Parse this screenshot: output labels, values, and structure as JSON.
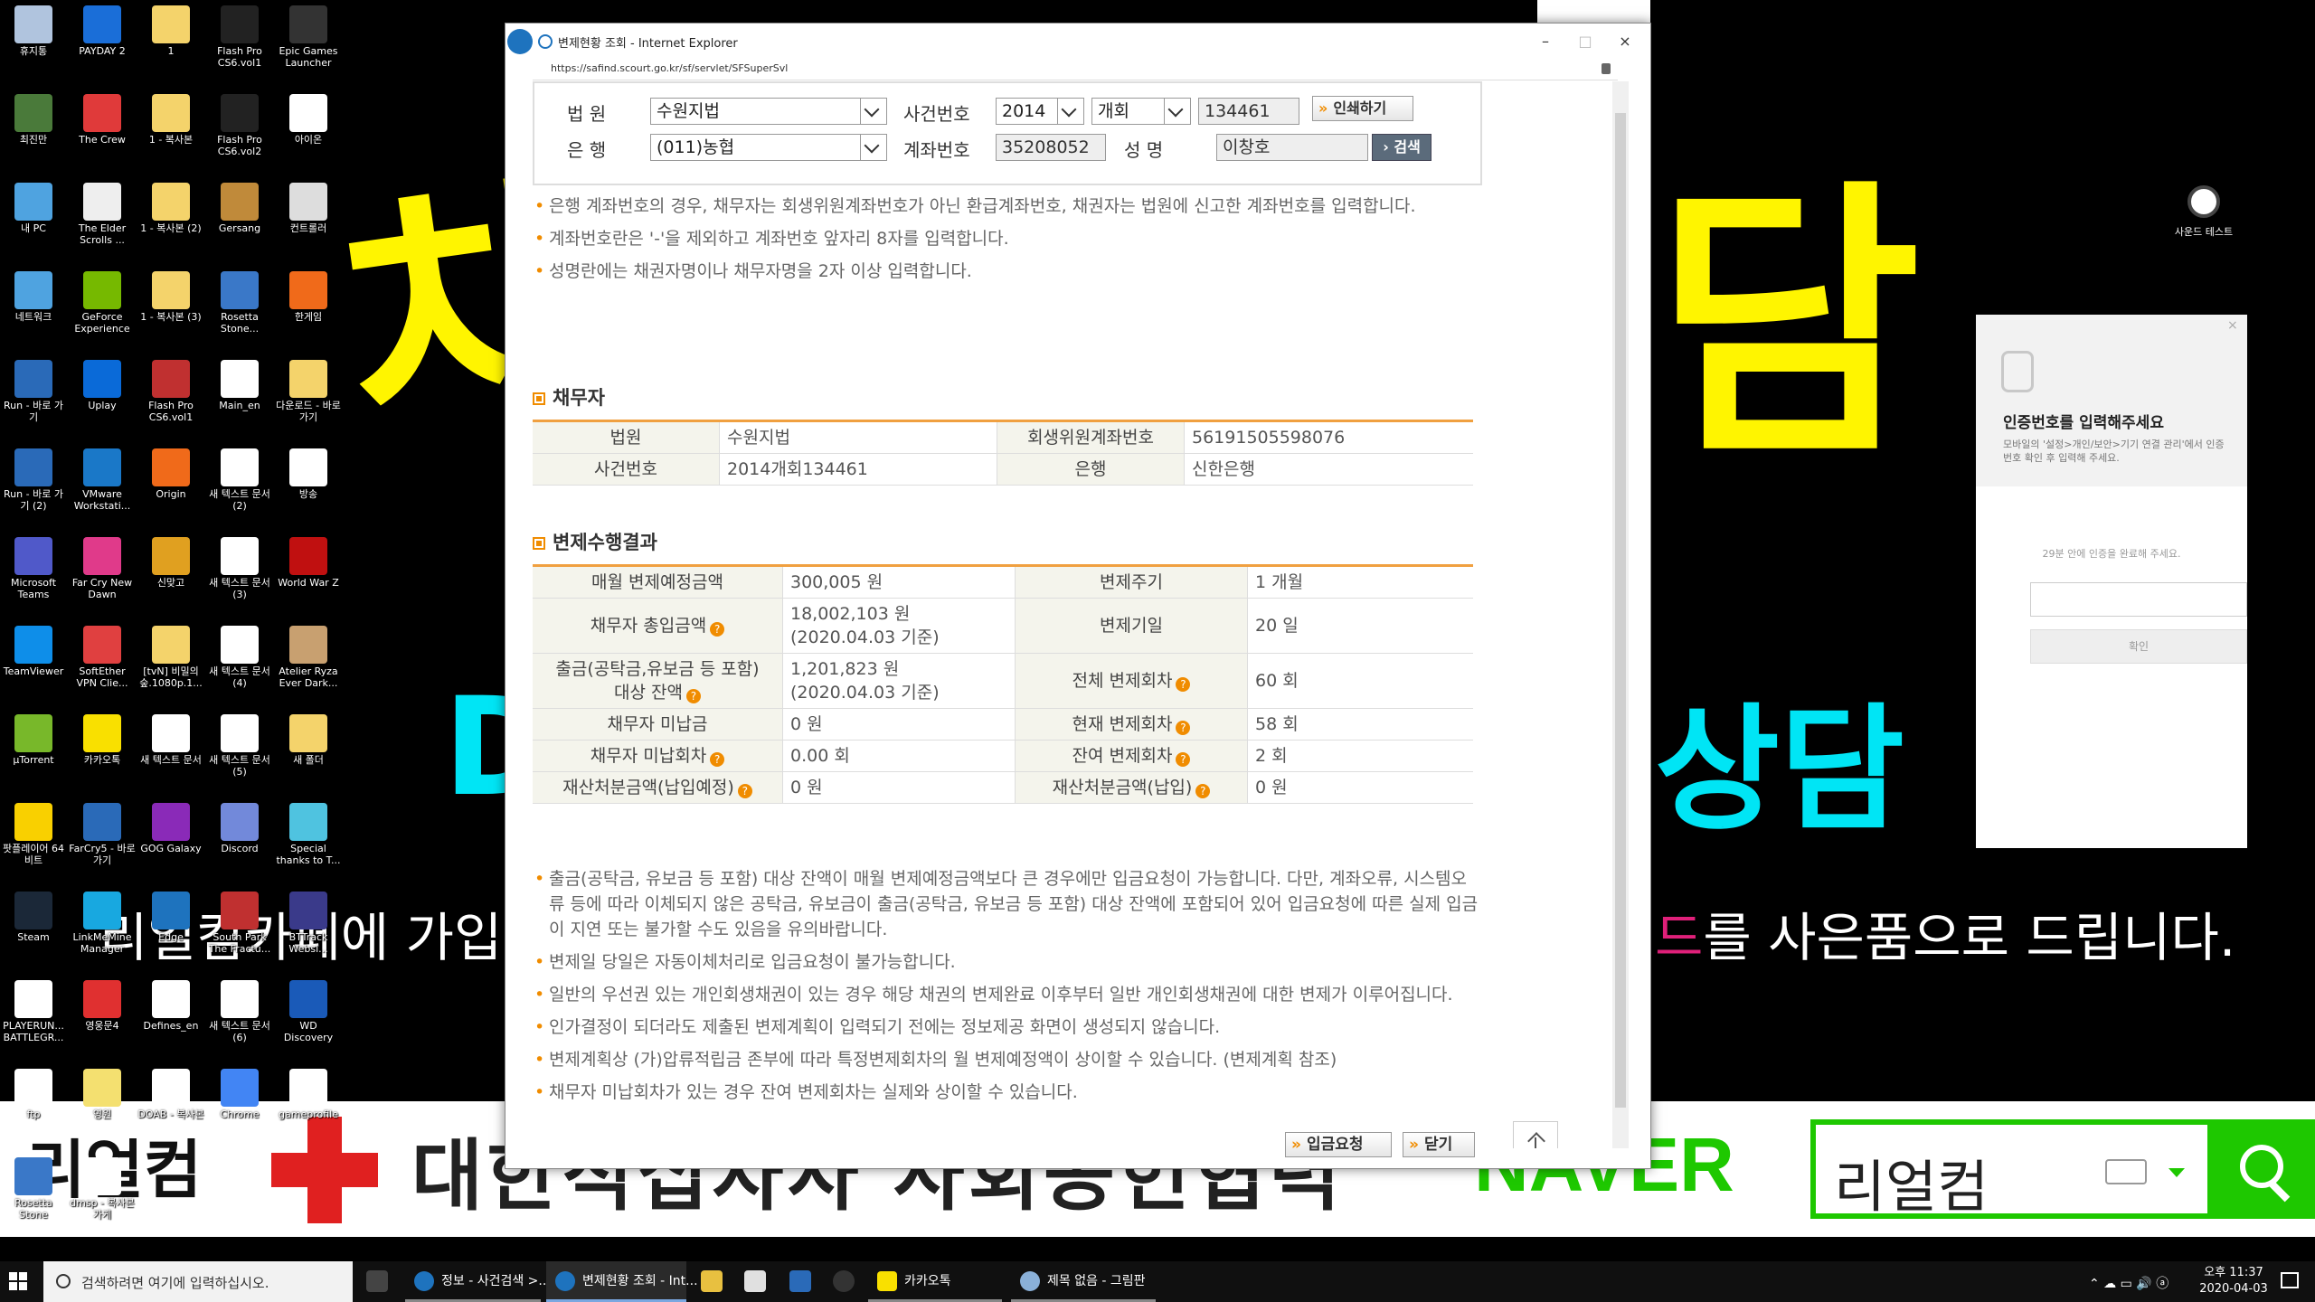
{
  "desktop": {
    "icons": [
      {
        "label": "휴지통",
        "color": "#b0c4de"
      },
      {
        "label": "PAYDAY 2",
        "color": "#1a6ed8"
      },
      {
        "label": "1",
        "color": "#f4d36b"
      },
      {
        "label": "Flash Pro CS6.vol1",
        "color": "#222"
      },
      {
        "label": "Epic Games Launcher",
        "color": "#333"
      },
      {
        "label": "최진만",
        "color": "#4a7a3a"
      },
      {
        "label": "The Crew",
        "color": "#e03a3a"
      },
      {
        "label": "1 - 복사본",
        "color": "#f4d36b"
      },
      {
        "label": "Flash Pro CS6.vol2",
        "color": "#222"
      },
      {
        "label": "아이온",
        "color": "#fff"
      },
      {
        "label": "내 PC",
        "color": "#4fa3e0"
      },
      {
        "label": "The Elder Scrolls ...",
        "color": "#eee"
      },
      {
        "label": "1 - 복사본 (2)",
        "color": "#f4d36b"
      },
      {
        "label": "Gersang",
        "color": "#c08a3a"
      },
      {
        "label": "컨트롤러",
        "color": "#ddd"
      },
      {
        "label": "네트워크",
        "color": "#4fa3e0"
      },
      {
        "label": "GeForce Experience",
        "color": "#76b900"
      },
      {
        "label": "1 - 복사본 (3)",
        "color": "#f4d36b"
      },
      {
        "label": "Rosetta Stone...",
        "color": "#3a78c8"
      },
      {
        "label": "한게임",
        "color": "#f06a1a"
      },
      {
        "label": "Run - 바로 가기",
        "color": "#2a6ab8"
      },
      {
        "label": "Uplay",
        "color": "#0a6ad8"
      },
      {
        "label": "Flash Pro CS6.vol1",
        "color": "#c03030"
      },
      {
        "label": "Main_en",
        "color": "#fff"
      },
      {
        "label": "다운로드 - 바로 가기",
        "color": "#f4d36b"
      },
      {
        "label": "Run - 바로 가기 (2)",
        "color": "#2a6ab8"
      },
      {
        "label": "VMware Workstati...",
        "color": "#1a78c8"
      },
      {
        "label": "Origin",
        "color": "#f06a1a"
      },
      {
        "label": "새 텍스트 문서 (2)",
        "color": "#fff"
      },
      {
        "label": "방송",
        "color": "#fff"
      },
      {
        "label": "Microsoft Teams",
        "color": "#5059c9"
      },
      {
        "label": "Far Cry New Dawn",
        "color": "#e03a8a"
      },
      {
        "label": "신맞고",
        "color": "#e0a020"
      },
      {
        "label": "새 텍스트 문서 (3)",
        "color": "#fff"
      },
      {
        "label": "World War Z",
        "color": "#c01010"
      },
      {
        "label": "TeamViewer",
        "color": "#0e8ee9"
      },
      {
        "label": "SoftEther VPN Clie...",
        "color": "#e04040"
      },
      {
        "label": "[tvN] 비밀의 숲.1080p.1...",
        "color": "#f4d36b"
      },
      {
        "label": "새 텍스트 문서 (4)",
        "color": "#fff"
      },
      {
        "label": "Atelier Ryza Ever Dark...",
        "color": "#c8a070"
      },
      {
        "label": "µTorrent",
        "color": "#78b82a"
      },
      {
        "label": "카카오톡",
        "color": "#f9e000"
      },
      {
        "label": "새 텍스트 문서",
        "color": "#fff"
      },
      {
        "label": "새 텍스트 문서 (5)",
        "color": "#fff"
      },
      {
        "label": "새 폴더",
        "color": "#f4d36b"
      },
      {
        "label": "팟플레이어 64 비트",
        "color": "#f9d000"
      },
      {
        "label": "FarCry5 - 바로 가기",
        "color": "#2a6ab8"
      },
      {
        "label": "GOG Galaxy",
        "color": "#8a2ab8"
      },
      {
        "label": "Discord",
        "color": "#7289da"
      },
      {
        "label": "Special thanks to T...",
        "color": "#4fc3e0"
      },
      {
        "label": "Steam",
        "color": "#1b2838"
      },
      {
        "label": "LinkMeMine Manager",
        "color": "#18a8e0"
      },
      {
        "label": "Edge",
        "color": "#1e73be"
      },
      {
        "label": "South Park The Fractu...",
        "color": "#c03030"
      },
      {
        "label": "BTTrack Websi...",
        "color": "#3a3a8a"
      },
      {
        "label": "PLAYERUN... BATTLEGR...",
        "color": "#fff"
      },
      {
        "label": "영웅문4",
        "color": "#e03030"
      },
      {
        "label": "Defines_en",
        "color": "#fff"
      },
      {
        "label": "새 텍스트 문서 (6)",
        "color": "#fff"
      },
      {
        "label": "WD Discovery",
        "color": "#1a5ab8"
      },
      {
        "label": "ftp",
        "color": "#fff"
      },
      {
        "label": "영원",
        "color": "#f4e070"
      },
      {
        "label": "DOAB - 복사본",
        "color": "#fff"
      },
      {
        "label": "Chrome",
        "color": "#4285f4"
      },
      {
        "label": "gameprofile",
        "color": "#fff"
      },
      {
        "label": "Rosetta Stone",
        "color": "#3a78c8"
      },
      {
        "label": "dmsp - 복사본 가게",
        "color": "#fff"
      }
    ],
    "sound_icon_label": "사운드 테스트"
  },
  "wallpaper": {
    "yellow_text_1": "차",
    "yellow_text_2": "담",
    "cyan_text_left": "D",
    "cyan_text_right": "상담",
    "white_line_left": "리얼컴카페에 가입후",
    "white_line_right_accent": "드",
    "white_line_right": "를 사은품으로 드립니다.",
    "banner_logo_text": "리얼컴",
    "banner_text": "대한적십자사 사회공헌협력",
    "naver_text": "NAVER",
    "naver_query": "리얼컴"
  },
  "auth_dialog": {
    "title": "인증번호를 입력해주세요",
    "description": "모바일의 '설정>개인/보안>기기 연결 관리'에서 인증번호 확인 후 입력해 주세요.",
    "timer_text": "29분 안에 인증을 완료해 주세요.",
    "confirm_label": "확인",
    "close_label": "×"
  },
  "ie": {
    "title": "변제현황 조회 - Internet Explorer",
    "url": "https://safind.scourt.go.kr/sf/servlet/SFSuperSvl",
    "min_label": "–",
    "max_label": "□",
    "close_label": "×"
  },
  "form": {
    "court_label": "법  원",
    "court_value": "수원지법",
    "case_label": "사건번호",
    "case_year": "2014",
    "case_type": "개회",
    "case_number": "134461",
    "print_label": "인쇄하기",
    "bank_label": "은  행",
    "bank_value": "(011)농협",
    "account_label": "계좌번호",
    "account_value": "35208052",
    "name_label": "성  명",
    "name_value": "이창호",
    "search_label": "검색"
  },
  "top_notes": [
    "은행 계좌번호의 경우, 채무자는 회생위원계좌번호가 아닌 환급계좌번호, 채권자는 법원에 신고한 계좌번호를 입력합니다.",
    "계좌번호란은 '-'을 제외하고 계좌번호 앞자리 8자를 입력합니다.",
    "성명란에는 채권자명이나 채무자명을 2자 이상 입력합니다."
  ],
  "debtor": {
    "section_title": "채무자",
    "court_h": "법원",
    "court_v": "수원지법",
    "account_h": "회생위원계좌번호",
    "account_v": "56191505598076",
    "case_h": "사건번호",
    "case_v": "2014개회134461",
    "bank_h": "은행",
    "bank_v": "신한은행"
  },
  "result": {
    "section_title": "변제수행결과",
    "monthly_h": "매월 변제예정금액",
    "monthly_v": "300,005 원",
    "cycle_h": "변제주기",
    "cycle_v": "1 개월",
    "total_in_h": "채무자 총입금액",
    "total_in_v1": "18,002,103 원",
    "total_in_v2": "(2020.04.03 기준)",
    "due_day_h": "변제기일",
    "due_day_v": "20 일",
    "withdraw_h1": "출금(공탁금,유보금 등 포함)",
    "withdraw_h2": "대상 잔액",
    "withdraw_v1": "1,201,823 원",
    "withdraw_v2": "(2020.04.03 기준)",
    "total_count_h": "전체 변제회차",
    "total_count_v": "60 회",
    "unpaid_h": "채무자 미납금",
    "unpaid_v": "0 원",
    "current_count_h": "현재 변제회차",
    "current_count_v": "58 회",
    "unpaid_count_h": "채무자 미납회차",
    "unpaid_count_v": "0.00 회",
    "remain_count_h": "잔여 변제회차",
    "remain_count_v": "2 회",
    "asset_plan_h": "재산처분금액(납입예정)",
    "asset_plan_v": "0 원",
    "asset_paid_h": "재산처분금액(납입)",
    "asset_paid_v": "0 원"
  },
  "bottom_notes": [
    "출금(공탁금, 유보금 등 포함) 대상 잔액이 매월 변제예정금액보다 큰 경우에만 입금요청이 가능합니다. 다만, 계좌오류, 시스템오류 등에 따라 이체되지 않은 공탁금, 유보금이 출금(공탁금, 유보금 등 포함) 대상 잔액에 포함되어 있어 입금요청에 따른 실제 입금이 지연 또는 불가할 수도 있음을 유의바랍니다.",
    "변제일 당일은 자동이체처리로 입금요청이 불가능합니다.",
    "일반의 우선권 있는 개인회생채권이 있는 경우 해당 채권의 변제완료 이후부터 일반 개인회생채권에 대한 변제가 이루어집니다.",
    "인가결정이 되더라도 제출된 변제계획이 입력되기 전에는 정보제공 화면이 생성되지 않습니다.",
    "변제계획상 (가)압류적립금 존부에 따라 특정변제회차의 월 변제예정액이 상이할 수 있습니다. (변제계획 참조)",
    "채무자 미납회차가 있는 경우 잔여 변제회차는 실제와 상이할 수 있습니다."
  ],
  "buttons": {
    "deposit_request": "입금요청",
    "close": "닫기"
  },
  "taskbar": {
    "search_placeholder": "검색하려면 여기에 입력하십시오.",
    "apps": [
      {
        "label": "정보 - 사건검색 >..."
      },
      {
        "label": "변제현황 조회 - Int..."
      },
      {
        "label": "카카오톡"
      },
      {
        "label": "제목 없음 - 그림판"
      }
    ],
    "time": "오후 11:37",
    "date": "2020-04-03"
  },
  "colors": {
    "accent_orange": "#f08c00",
    "naver_green": "#1ec800",
    "wallpaper_yellow": "#fff500"
  }
}
